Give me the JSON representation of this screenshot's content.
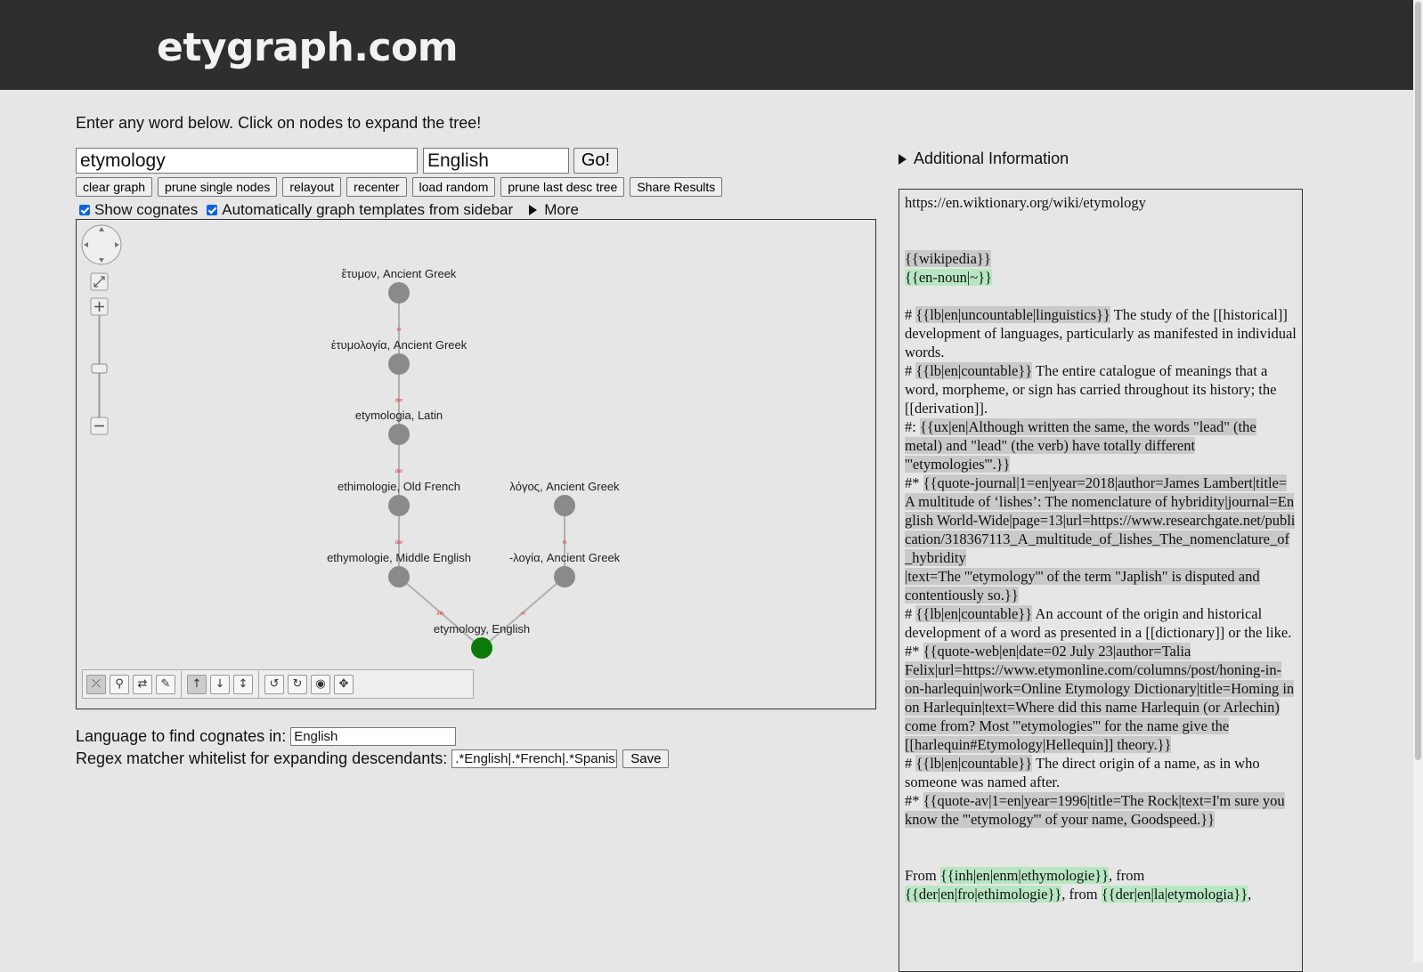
{
  "header": {
    "site_title": "etygraph.com"
  },
  "intro_text": "Enter any word below. Click on nodes to expand the tree!",
  "search": {
    "word_value": "etymology",
    "language_value": "English",
    "go_label": "Go!"
  },
  "toolbar_buttons": [
    "clear graph",
    "prune single nodes",
    "relayout",
    "recenter",
    "load random",
    "prune last desc tree",
    "Share Results"
  ],
  "options": {
    "show_cognates_label": "Show cognates",
    "auto_graph_label": "Automatically graph templates from sidebar",
    "more_label": "More"
  },
  "graph": {
    "nodes": [
      {
        "id": "n1",
        "label": "ἔτυμον, Ancient Greek"
      },
      {
        "id": "n2",
        "label": "ἐτυμολογία, Ancient Greek"
      },
      {
        "id": "n3",
        "label": "etymologia, Latin"
      },
      {
        "id": "n4",
        "label": "ethimologie, Old French"
      },
      {
        "id": "n5",
        "label": "λόγος, Ancient Greek"
      },
      {
        "id": "n6",
        "label": "ethymologie, Middle English"
      },
      {
        "id": "n7",
        "label": "-λογία, Ancient Greek"
      },
      {
        "id": "n8",
        "label": "etymology, English"
      }
    ],
    "edges": [
      {
        "from": "n1",
        "to": "n2",
        "label": "m"
      },
      {
        "from": "n2",
        "to": "n3",
        "label": "der"
      },
      {
        "from": "n3",
        "to": "n4",
        "label": "der"
      },
      {
        "from": "n4",
        "to": "n6",
        "label": "der"
      },
      {
        "from": "n5",
        "to": "n7",
        "label": "m"
      },
      {
        "from": "n6",
        "to": "n8",
        "label": "inh"
      },
      {
        "from": "n7",
        "to": "n8",
        "label": "m"
      }
    ],
    "colors": {
      "node": "#8a8a8a",
      "root_node": "#0b7a0b",
      "edge": "#b0b0b0",
      "edge_label": "#e03030"
    }
  },
  "cognates": {
    "label": "Language to find cognates in:",
    "value": "English"
  },
  "regex": {
    "label": "Regex matcher whitelist for expanding descendants:",
    "value": ".*English|.*French|.*Spanish",
    "save_label": "Save"
  },
  "additional_info_label": "Additional Information",
  "wiki": {
    "url": "https://en.wiktionary.org/wiki/etymology",
    "t_wikipedia": "{{wikipedia}}",
    "t_en_noun": "{{en-noun|~}}",
    "d1_prefix": "# ",
    "d1_tpl": "{{lb|en|uncountable|linguistics}}",
    "d1_text": " The study of the [[historical]] development of languages, particularly as manifested in individual words.",
    "d2_prefix": "# ",
    "d2_tpl": "{{lb|en|countable}}",
    "d2_text": " The entire catalogue of meanings that a word, morpheme, or sign has carried throughout its history; the [[derivation]].",
    "ux_prefix": "#: ",
    "ux_tpl": "{{ux|en|Although written the same, the words \"lead\" (the metal) and \"lead\" (the verb) have totally different '''etymologies'''.}}",
    "q1_prefix": "#* ",
    "q1_tpl": "{{quote-journal|1=en|year=2018|author=James Lambert|title=A multitude of ‘lishes’: The nomenclature of hybridity|journal=English World-Wide|page=13|url=https://www.researchgate.net/publication/318367113_A_multitude_of_lishes_The_nomenclature_of_hybridity",
    "q1_tpl2": "|text=The '''etymology''' of the term \"Japlish\" is disputed and contentiously so.}}",
    "d3_prefix": "# ",
    "d3_tpl": "{{lb|en|countable}}",
    "d3_text": " An account of the origin and historical development of a word as presented in a [[dictionary]] or the like.",
    "q2_prefix": "#* ",
    "q2_tpl": "{{quote-web|en|date=02 July 23|author=Talia Felix|url=https://www.etymonline.com/columns/post/honing-in-on-harlequin|work=Online Etymology Dictionary|title=Homing in on Harlequin|text=Where did this name Harlequin (or Arlechin) come from? Most '''etymologies''' for the name give the [[harlequin#Etymology|Hellequin]] theory.}}",
    "d4_prefix": "# ",
    "d4_tpl": "{{lb|en|countable}}",
    "d4_text": " The direct origin of a name, as in who someone was named after.",
    "q3_prefix": "#* ",
    "q3_tpl": "{{quote-av|1=en|year=1996|title=The Rock|text=I'm sure you know the '''etymology''' of your name, Goodspeed.}}",
    "et_from": "From ",
    "et_inh": "{{inh|en|enm|ethymologie}}",
    "et_from2": ", from ",
    "et_der1": "{{der|en|fro|ethimologie}}",
    "et_from3": ", from ",
    "et_der2": "{{der|en|la|etymologia}}",
    "et_comma": ","
  }
}
